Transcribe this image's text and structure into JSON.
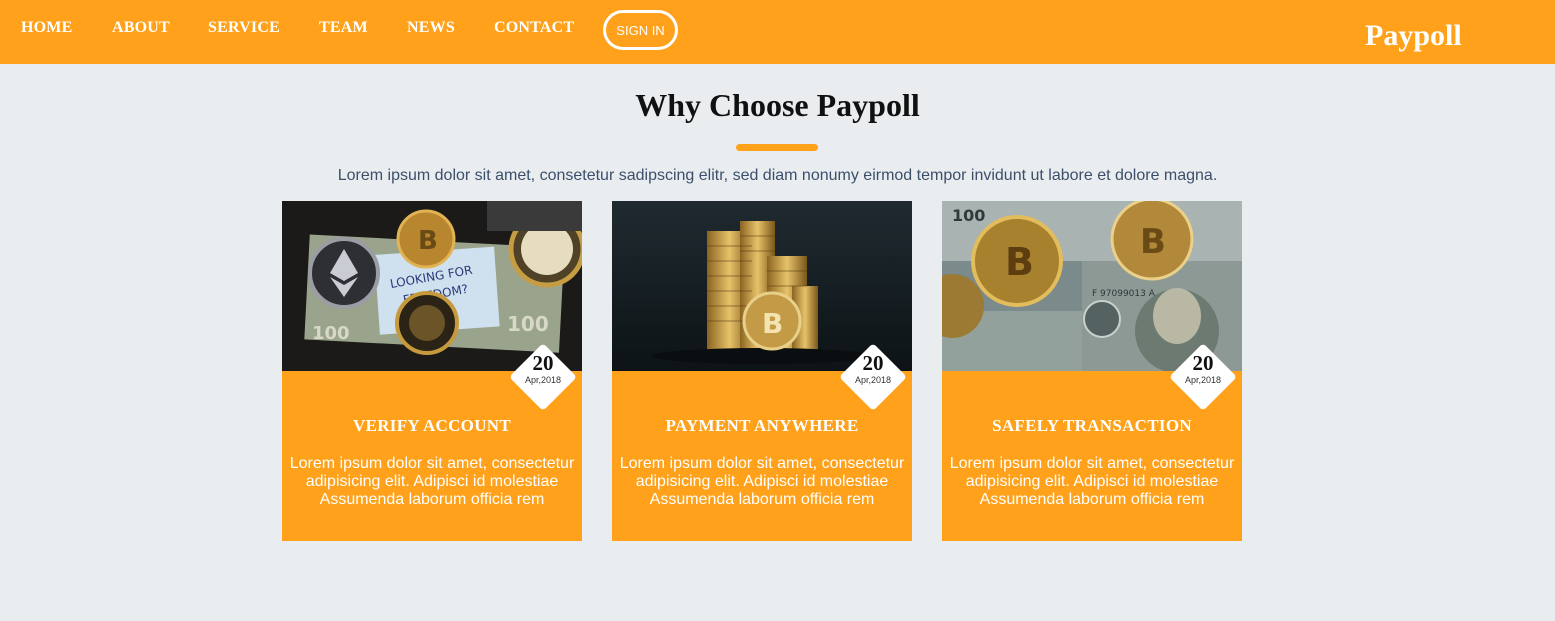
{
  "nav": {
    "items": [
      {
        "label": "HOME"
      },
      {
        "label": "ABOUT"
      },
      {
        "label": "SERVICE"
      },
      {
        "label": "TEAM"
      },
      {
        "label": "NEWS"
      },
      {
        "label": "CONTACT"
      }
    ],
    "signin_label": "SIGN IN",
    "brand": "Paypoll"
  },
  "section": {
    "title": "Why Choose Paypoll",
    "subtitle": "Lorem ipsum dolor sit amet, consetetur sadipscing elitr, sed diam nonumy eirmod tempor invidunt ut labore et dolore magna."
  },
  "cards": [
    {
      "day": "20",
      "date": "Apr,2018",
      "title": "VERIFY ACCOUNT",
      "text": "Lorem ipsum dolor sit amet, consectetur adipisicing elit. Adipisci id molestiae Assumenda laborum officia rem"
    },
    {
      "day": "20",
      "date": "Apr,2018",
      "title": "PAYMENT ANYWHERE",
      "text": "Lorem ipsum dolor sit amet, consectetur adipisicing elit. Adipisci id molestiae Assumenda laborum officia rem"
    },
    {
      "day": "20",
      "date": "Apr,2018",
      "title": "SAFELY TRANSACTION",
      "text": "Lorem ipsum dolor sit amet, consectetur adipisicing elit. Adipisci id molestiae Assumenda laborum officia rem"
    }
  ],
  "colors": {
    "accent": "#ffa11a",
    "background": "#eaedf0"
  }
}
